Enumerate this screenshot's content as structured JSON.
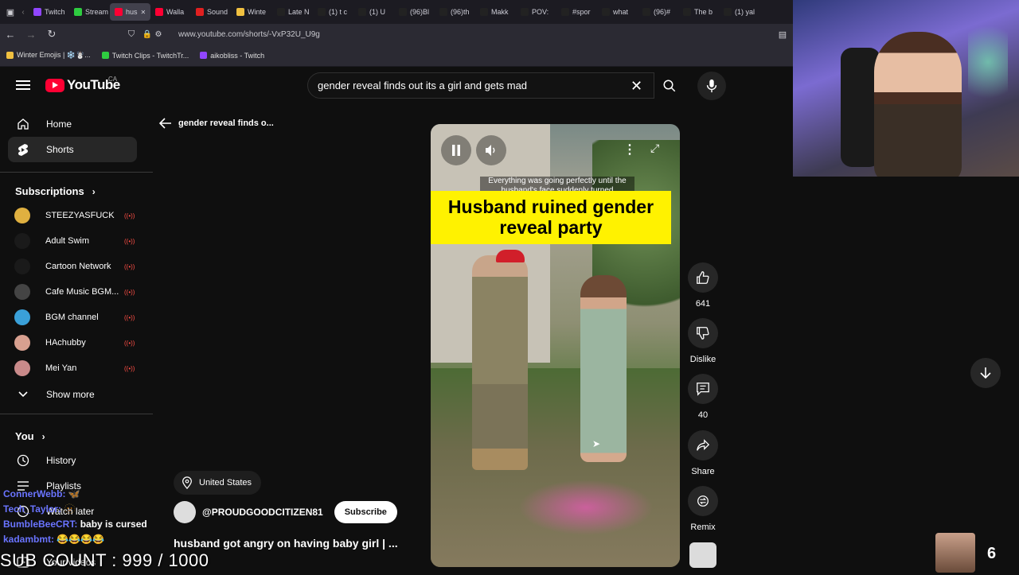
{
  "browser": {
    "tabs": [
      {
        "label": "Twitch",
        "color": "#9146ff"
      },
      {
        "label": "Stream",
        "color": "#2ecc40"
      },
      {
        "label": "hus",
        "color": "#ff0033",
        "active": true
      },
      {
        "label": "Walla",
        "color": "#ff0033"
      },
      {
        "label": "Sound",
        "color": "#e02020"
      },
      {
        "label": "Winte",
        "color": "#f0c040"
      },
      {
        "label": "Late N",
        "color": "#222222"
      },
      {
        "label": "(1) t c",
        "color": "#222222"
      },
      {
        "label": "(1) U",
        "color": "#222222"
      },
      {
        "label": "(96)Bl",
        "color": "#222222"
      },
      {
        "label": "(96)th",
        "color": "#222222"
      },
      {
        "label": "Makk",
        "color": "#222222"
      },
      {
        "label": "POV:",
        "color": "#222222"
      },
      {
        "label": "#spor",
        "color": "#222222"
      },
      {
        "label": "what",
        "color": "#222222"
      },
      {
        "label": "(96)#",
        "color": "#222222"
      },
      {
        "label": "The b",
        "color": "#222222"
      },
      {
        "label": "(1) yal",
        "color": "#222222"
      }
    ],
    "url": "www.youtube.com/shorts/-VxP32U_U9g",
    "bookmarks": [
      {
        "label": "Winter Emojis | ❄️☃️...",
        "color": "#f0c040"
      },
      {
        "label": "Twitch Clips - TwitchTr...",
        "color": "#2ecc40"
      },
      {
        "label": "aikobliss - Twitch",
        "color": "#9146ff"
      }
    ]
  },
  "header": {
    "logo_text": "YouTube",
    "logo_region": "CA",
    "search_query": "gender reveal finds out its a girl and gets mad"
  },
  "sidebar": {
    "nav": [
      {
        "label": "Home",
        "icon": "home-icon"
      },
      {
        "label": "Shorts",
        "icon": "shorts-icon",
        "active": true
      }
    ],
    "subscriptions_title": "Subscriptions",
    "subscriptions": [
      {
        "name": "STEEZYASFUCK",
        "color": "#e0b040"
      },
      {
        "name": "Adult Swim",
        "color": "#1a1a1a"
      },
      {
        "name": "Cartoon Network",
        "color": "#1a1a1a"
      },
      {
        "name": "Cafe Music BGM...",
        "color": "#444444"
      },
      {
        "name": "BGM channel",
        "color": "#3aa0d8"
      },
      {
        "name": "HAchubby",
        "color": "#d8a090"
      },
      {
        "name": "Mei Yan",
        "color": "#c98a8a"
      }
    ],
    "show_more": "Show more",
    "you_title": "You",
    "you_items": [
      {
        "label": "History",
        "icon": "history-icon"
      },
      {
        "label": "Playlists",
        "icon": "playlists-icon"
      },
      {
        "label": "Watch later",
        "icon": "watch-later-icon"
      },
      {
        "label": "Your videos",
        "icon": "your-videos-icon"
      }
    ]
  },
  "shorts": {
    "back_label": "gender reveal finds o...",
    "caption_small": "Everything was going perfectly until the husband's face suddenly turned",
    "title_banner": "Husband ruined gender reveal party",
    "actions": {
      "likes": "641",
      "dislike": "Dislike",
      "comments": "40",
      "share": "Share",
      "remix": "Remix"
    },
    "location": "United States",
    "channel_handle": "@PROUDGOODCITIZEN81",
    "subscribe_label": "Subscribe",
    "short_title": "husband got angry on having baby girl | ..."
  },
  "overlay": {
    "chat": [
      {
        "user": "ConnerWebb:",
        "msg": "🦋"
      },
      {
        "user": "Tech_Taylor:",
        "msg": "🫥"
      },
      {
        "user": "BumbleBeeCRT:",
        "msg": "baby is cursed"
      },
      {
        "user": "kadambmt:",
        "msg": "😂😂😂😂"
      }
    ],
    "sub_count": "SUB COUNT : 999 / 1000",
    "counter": "6"
  }
}
